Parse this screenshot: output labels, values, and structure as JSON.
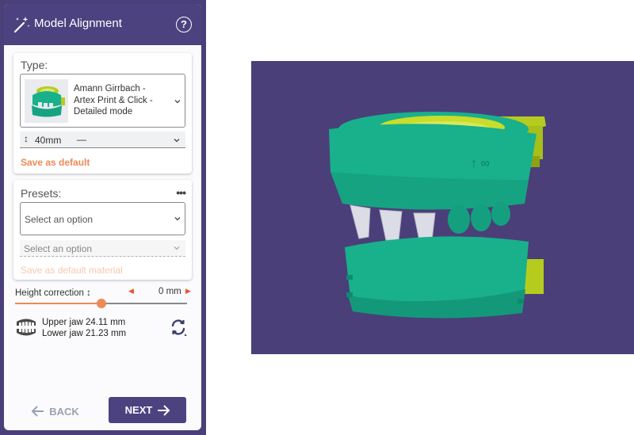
{
  "header": {
    "title": "Model Alignment",
    "help_glyph": "?"
  },
  "type_section": {
    "label": "Type:",
    "selected": "Amann Girrbach - Artex Print & Click - Detailed mode",
    "height": {
      "value": "40mm",
      "extra": "—"
    },
    "save_default": "Save as default"
  },
  "presets_section": {
    "label": "Presets:",
    "menu_glyph": "•••",
    "select_placeholder": "Select an option",
    "sub_placeholder": "Select an option",
    "save_material": "Save as default material"
  },
  "height_correction": {
    "label": "Height correction",
    "icon_glyph": "↕",
    "value": "0 mm",
    "slider_fraction": 0.5
  },
  "jaw_info": {
    "upper": "Upper jaw 24.11 mm",
    "lower": "Lower jaw 21.23 mm"
  },
  "nav": {
    "back": "BACK",
    "next": "NEXT"
  },
  "colors": {
    "accent": "#4c4280",
    "orange": "#ee8a55",
    "viewport_bg": "#4a3f78",
    "model_teal": "#19b08c",
    "articulator_yellow": "#b5cc1e"
  },
  "icons": {
    "wand": "magic-wand-icon",
    "help": "help-circle-icon",
    "swap": "swap-jaws-icon",
    "teeth": "teeth-icon"
  }
}
